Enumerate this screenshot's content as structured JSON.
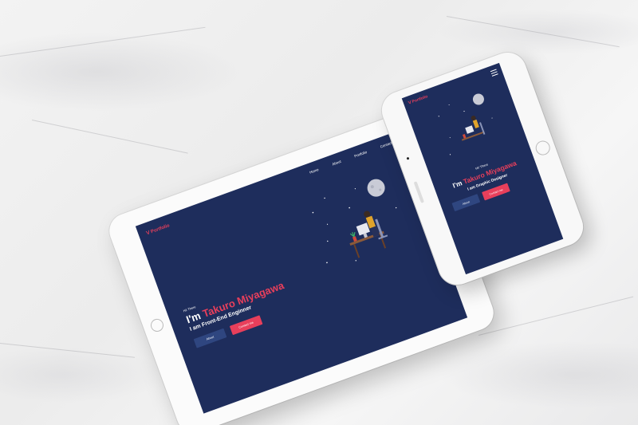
{
  "scene": {
    "colors": {
      "screen_bg": "#1e2d5c",
      "accent": "#e83f5b",
      "button_secondary": "#2f4680",
      "marble": "#efefef"
    }
  },
  "tablet": {
    "logo": "ᐯ Portfolio",
    "nav": [
      "Home",
      "About",
      "Portfolio",
      "Contact"
    ],
    "greeting": "Hi! There",
    "name_prefix": "I'm ",
    "name": "Takuro Miyagawa",
    "role": "I am Front-End Enginner",
    "about_button": "About",
    "contact_button": "Contact me"
  },
  "phone": {
    "logo": "ᐯ Portfolio",
    "greeting": "Hi! There",
    "name_prefix": "I'm ",
    "name": "Takuro Miyagawa",
    "role": "I am Graphic Designer",
    "about_button": "About",
    "contact_button": "Contact me"
  }
}
